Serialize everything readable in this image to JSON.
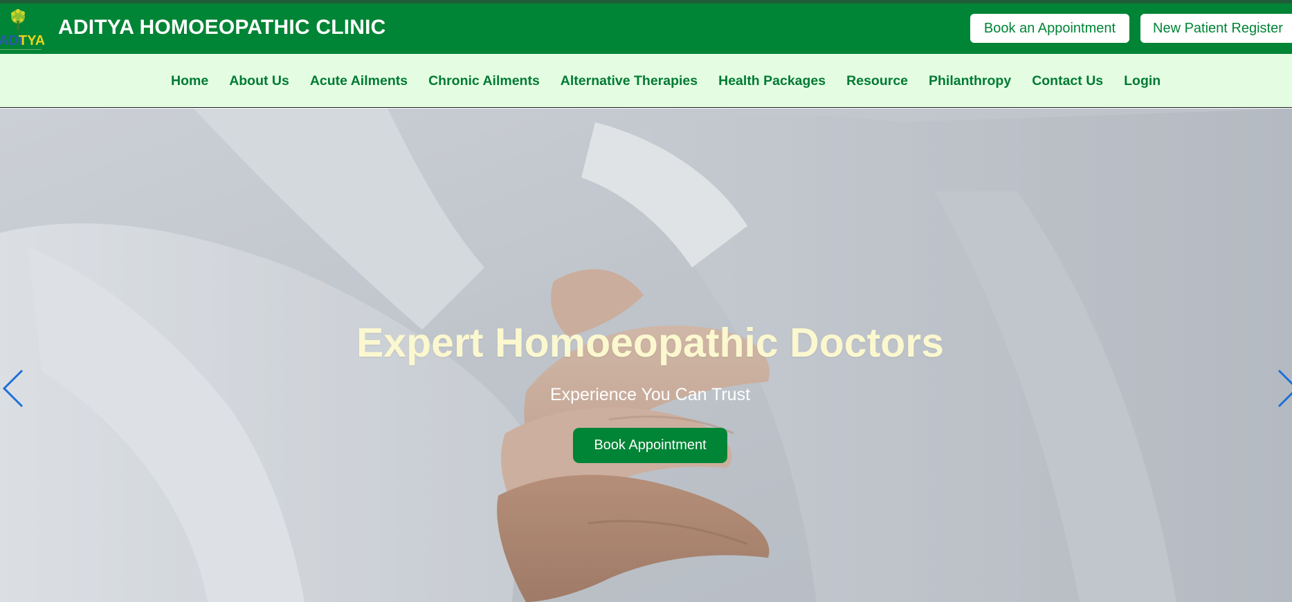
{
  "header": {
    "brand_title": "ADITYA HOMOEOPATHIC CLINIC",
    "logo_text_left": "ADI",
    "logo_text_right": "TYA",
    "book_appointment_label": "Book an Appointment",
    "new_patient_label": "New Patient Register"
  },
  "nav": {
    "items": [
      {
        "label": "Home"
      },
      {
        "label": "About Us"
      },
      {
        "label": "Acute Ailments"
      },
      {
        "label": "Chronic Ailments"
      },
      {
        "label": "Alternative Therapies"
      },
      {
        "label": "Health Packages"
      },
      {
        "label": "Resource"
      },
      {
        "label": "Philanthropy"
      },
      {
        "label": "Contact Us"
      },
      {
        "label": "Login"
      }
    ]
  },
  "hero": {
    "title": "Expert Homoeopathic Doctors",
    "subtitle": "Experience You Can Trust",
    "cta_label": "Book Appointment",
    "prev_icon": "chevron-left-icon",
    "next_icon": "chevron-right-icon"
  },
  "colors": {
    "brand_green": "#008435",
    "nav_background": "#e4fde2",
    "nav_text": "#007a33",
    "hero_title": "#fbf8cf",
    "carousel_arrow": "#1e6fd9"
  }
}
